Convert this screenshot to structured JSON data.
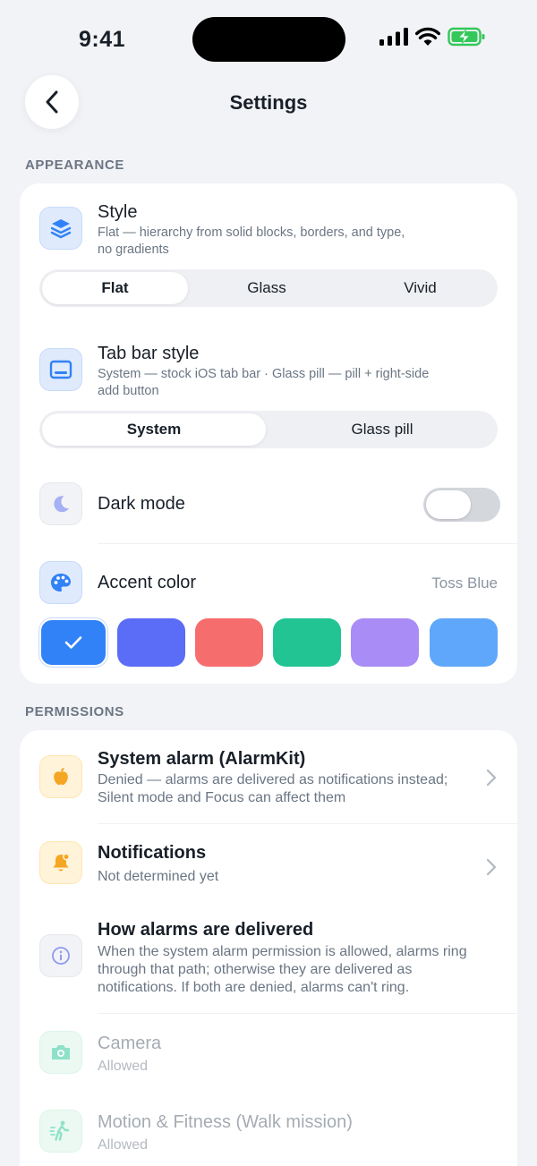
{
  "status": {
    "time": "9:41"
  },
  "nav": {
    "title": "Settings"
  },
  "sections": {
    "appearance": "APPEARANCE",
    "permissions": "PERMISSIONS"
  },
  "appearance": {
    "style": {
      "title": "Style",
      "subtitle_line1": "Flat — hierarchy from solid blocks, borders, and type,",
      "subtitle_line2": "no gradients",
      "options": [
        "Flat",
        "Glass",
        "Vivid"
      ],
      "selected": "Flat"
    },
    "tab_bar": {
      "title": "Tab bar style",
      "subtitle_line1": "System — stock iOS tab bar · Glass pill — pill + right-side",
      "subtitle_line2": "add button",
      "options": [
        "System",
        "Glass pill"
      ],
      "selected": "System"
    },
    "dark_mode": {
      "title": "Dark mode",
      "on": false
    },
    "accent": {
      "title": "Accent color",
      "value": "Toss Blue",
      "swatches": [
        "#3182f6",
        "#5b6cf6",
        "#f66d6d",
        "#22c494",
        "#a98cf6",
        "#5fa7fa"
      ],
      "selected_index": 0
    }
  },
  "permissions": {
    "system_alarm": {
      "title": "System alarm (AlarmKit)",
      "subtitle_line1": "Denied — alarms are delivered as notifications instead;",
      "subtitle_line2": "Silent mode and Focus can affect them"
    },
    "notifications": {
      "title": "Notifications",
      "subtitle": "Not determined yet"
    },
    "delivery": {
      "title": "How alarms are delivered",
      "line1": "When the system alarm permission is allowed, alarms ring",
      "line2": "through that path; otherwise they are delivered as",
      "line3": "notifications. If both are denied, alarms can't ring."
    },
    "camera": {
      "title": "Camera",
      "subtitle": "Allowed"
    },
    "motion": {
      "title": "Motion & Fitness (Walk mission)",
      "subtitle": "Allowed"
    }
  },
  "colors": {
    "accent": "#3182f6",
    "background": "#f2f3f6",
    "card": "#ffffff"
  }
}
